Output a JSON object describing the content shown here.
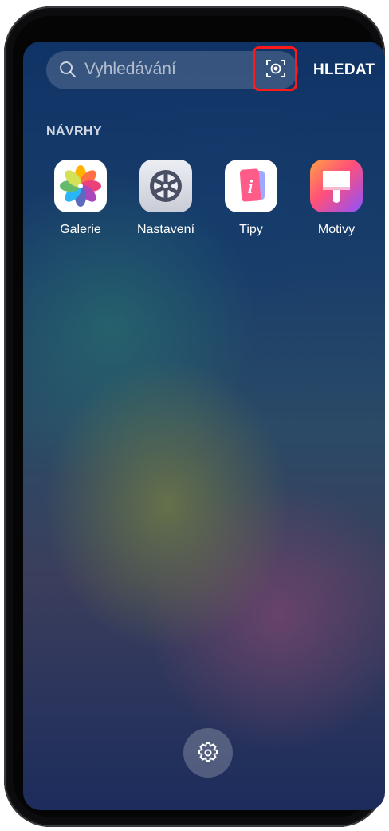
{
  "search": {
    "placeholder": "Vyhledávání",
    "search_button_label": "HLEDAT"
  },
  "suggestions": {
    "title": "NÁVRHY",
    "apps": [
      {
        "label": "Galerie",
        "icon": "gallery-icon"
      },
      {
        "label": "Nastavení",
        "icon": "settings-app-icon"
      },
      {
        "label": "Tipy",
        "icon": "tips-icon"
      },
      {
        "label": "Motivy",
        "icon": "themes-icon"
      }
    ]
  },
  "bottom": {
    "icon": "gear-icon"
  },
  "colors": {
    "highlight": "#ff1a1a",
    "accent_text": "#ffffff"
  }
}
